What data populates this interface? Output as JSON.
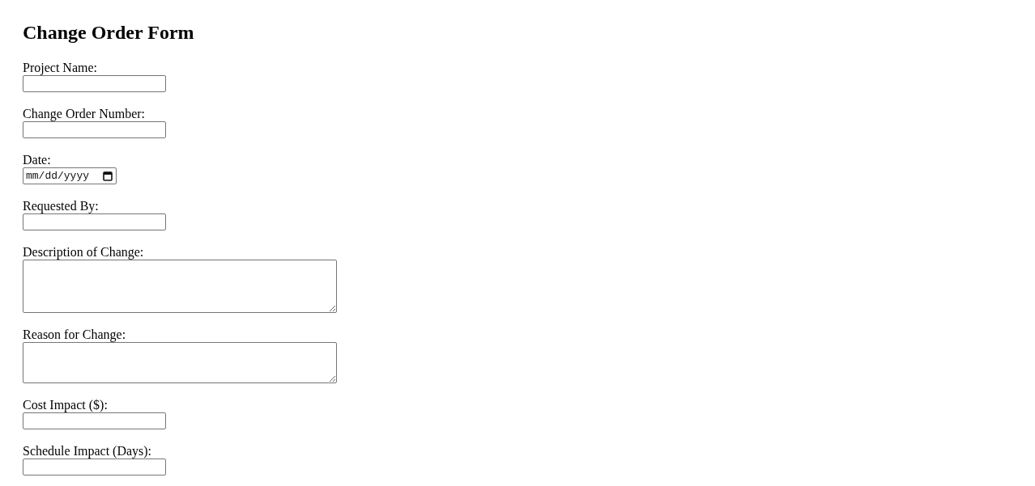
{
  "title": "Change Order Form",
  "fields": [
    {
      "label": "Project Name:",
      "kind": "text"
    },
    {
      "label": "Change Order Number:",
      "kind": "text"
    },
    {
      "label": "Date:",
      "kind": "date",
      "placeholder": "mm/dd/yyyy"
    },
    {
      "label": "Requested By:",
      "kind": "text"
    },
    {
      "label": "Description of Change:",
      "kind": "textarea-tall"
    },
    {
      "label": "Reason for Change:",
      "kind": "textarea"
    },
    {
      "label": "Cost Impact ($):",
      "kind": "text"
    },
    {
      "label": "Schedule Impact (Days):",
      "kind": "text"
    }
  ]
}
